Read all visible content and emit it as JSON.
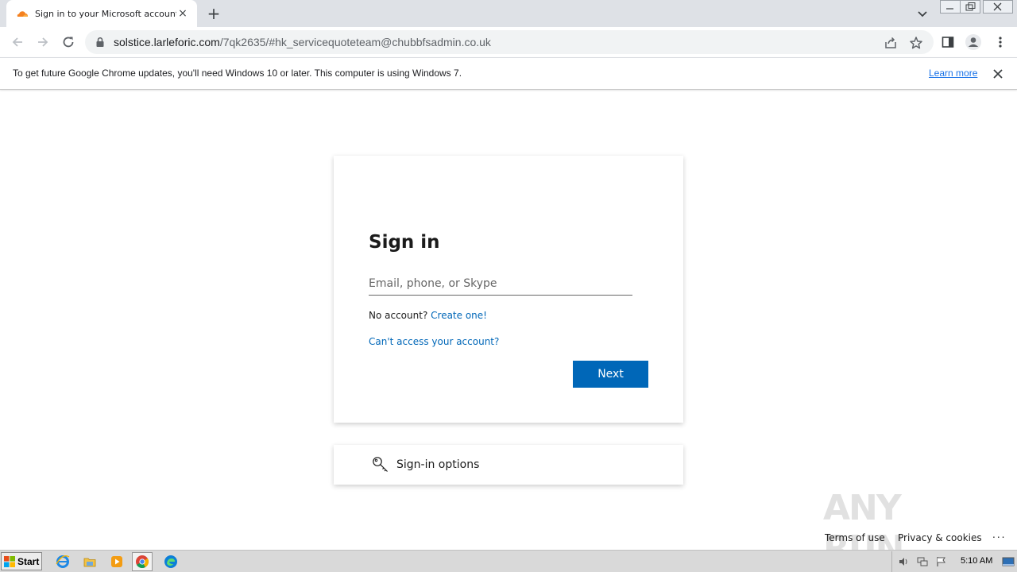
{
  "tab": {
    "title": "Sign in to your Microsoft account",
    "close_icon": "×",
    "new_tab_icon": "+"
  },
  "address_bar": {
    "host": "solstice.larleforic.com",
    "path": "/7qk2635/#hk_servicequoteteam@chubbfsadmin.co.uk"
  },
  "infobar": {
    "message": "To get future Google Chrome updates, you'll need Windows 10 or later. This computer is using Windows 7.",
    "learn_more": "Learn more"
  },
  "signin": {
    "heading": "Sign in",
    "email_placeholder": "Email, phone, or Skype",
    "email_value": "",
    "no_account": "No account?",
    "create_one": "Create one!",
    "cant_access": "Can't access your account?",
    "next": "Next"
  },
  "signin_options": {
    "label": "Sign-in options"
  },
  "footer": {
    "terms": "Terms of use",
    "privacy": "Privacy & cookies",
    "more": "..."
  },
  "watermark": {
    "text": "ANY RUN"
  },
  "taskbar": {
    "start": "Start",
    "apps": [
      "ie-icon",
      "explorer-icon",
      "media-player-icon",
      "chrome-icon",
      "edge-icon"
    ],
    "clock": "5:10 AM"
  },
  "colors": {
    "accent": "#0067b8",
    "chrome_link": "#1a73e8",
    "tabstrip": "#dee1e6"
  }
}
